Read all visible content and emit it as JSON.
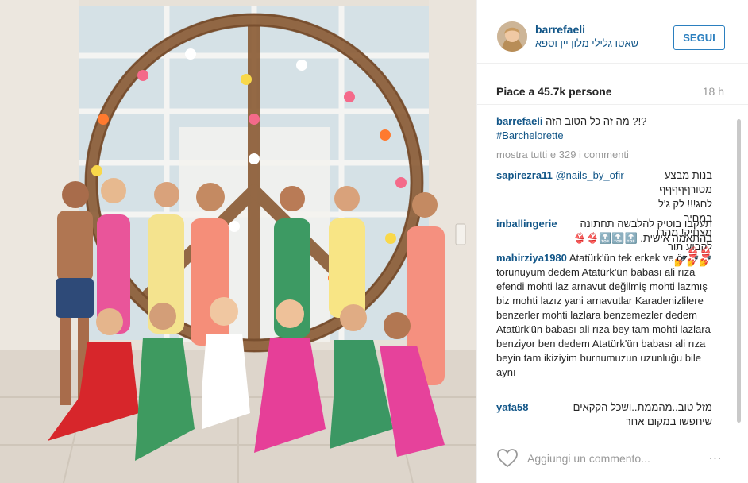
{
  "post": {
    "username": "barrefaeli",
    "location": "שאטו גלילי מלון יין וספא",
    "follow_label": "SEGUI",
    "likes": "Piace a 45.7k persone",
    "time": "18 h"
  },
  "caption": {
    "user": "barrefaeli",
    "text": "?!? מה זה כל הטוב הזה",
    "hashtag": "#Barchelorette"
  },
  "show_all_label": "mostra tutti e 329 i commenti",
  "comments": [
    {
      "user": "sapirezra11",
      "mention": "@nails_by_ofir",
      "text": "בנות מבצע מטורףףףףף לחג!!! לק ג'ל במחיר מצחיק! מהרו לקבוע תור 💅💅💅"
    },
    {
      "user": "inballingerie",
      "text": "תעקבו בוטיק להלבשה תחתונה בהתאמה אישית. 🔝🔝🔝👙👙👙👙"
    },
    {
      "user": "mahirziya1980",
      "text": "Atatürk'ün tek erkek ve öz torunuyum dedem Atatürk'ün babası ali rıza efendi mohti laz arnavut değilmiş mohti lazmış biz mohti lazız yani arnavutlar Karadenizlilere benzerler mohti lazlara benzemezler dedem Atatürk'ün babası ali rıza bey tam mohti lazlara benziyor ben dedem Atatürk'ün babası ali rıza beyin tam ikiziyim burnumuzun uzunluğu bile aynı"
    },
    {
      "user": "yafa58",
      "text": "מזל טוב..מהממת..ושכל הקקאים שיחפשו במקום אחר"
    }
  ],
  "footer": {
    "add_comment_placeholder": "Aggiungi un commento...",
    "more_label": "..."
  },
  "icons": {
    "like": "heart-icon",
    "more": "more-options-icon"
  },
  "colors": {
    "link": "#125688",
    "follow": "#2b7fbf",
    "muted": "#999999"
  }
}
